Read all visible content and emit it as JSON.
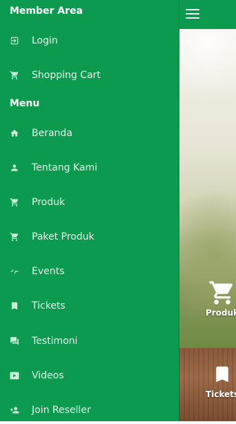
{
  "colors": {
    "drawer_bg": "#0b9a4e",
    "topbar_bg": "#0b9a4e",
    "text": "#ffffff"
  },
  "topbar": {
    "menu_icon": "hamburger-icon"
  },
  "member_area": {
    "title": "Member Area",
    "items": [
      {
        "label": "Login",
        "icon": "login-icon"
      },
      {
        "label": "Shopping Cart",
        "icon": "cart-icon"
      }
    ]
  },
  "menu": {
    "title": "Menu",
    "items": [
      {
        "label": "Beranda",
        "icon": "home-icon"
      },
      {
        "label": "Tentang Kami",
        "icon": "person-icon"
      },
      {
        "label": "Produk",
        "icon": "cart-icon"
      },
      {
        "label": "Paket Produk",
        "icon": "cart-icon"
      },
      {
        "label": "Events",
        "icon": "pulse-icon"
      },
      {
        "label": "Tickets",
        "icon": "bookmark-icon"
      },
      {
        "label": "Testimoni",
        "icon": "chat-icon"
      },
      {
        "label": "Videos",
        "icon": "video-icon"
      },
      {
        "label": "Join Reseller",
        "icon": "person-add-icon"
      }
    ]
  },
  "background": {
    "features": [
      {
        "label": "Produk",
        "icon": "cart-icon"
      },
      {
        "label": "Tickets",
        "icon": "bookmark-icon"
      }
    ]
  }
}
